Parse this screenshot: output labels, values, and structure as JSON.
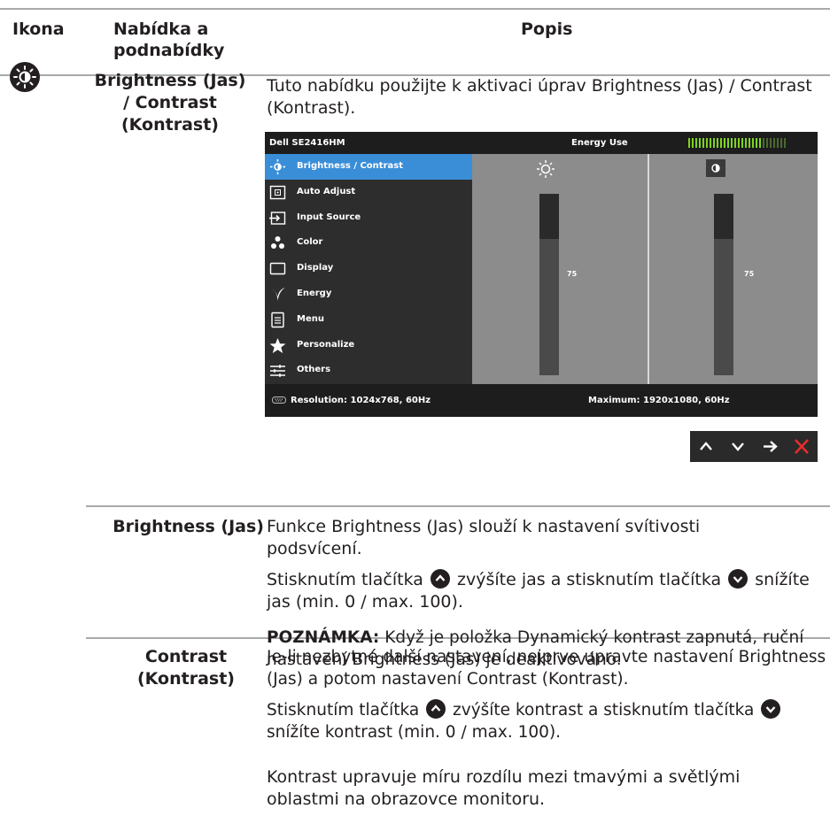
{
  "table": {
    "headers": {
      "icon": "Ikona",
      "menu": "Nabídka a podnabídky",
      "desc": "Popis"
    }
  },
  "main_row": {
    "menu_name": "Brightness (Jas) / Contrast (Kontrast)",
    "description": "Tuto nabídku použijte k aktivaci úprav Brightness (Jas) / Contrast (Kontrast)."
  },
  "osd": {
    "title": "Dell SE2416HM",
    "energy_label": "Energy Use",
    "energy_level": 0.75,
    "menu_items": [
      {
        "label": "Brightness / Contrast",
        "icon": "brightness-icon",
        "selected": true
      },
      {
        "label": "Auto Adjust",
        "icon": "auto-adjust-icon",
        "selected": false
      },
      {
        "label": "Input Source",
        "icon": "input-source-icon",
        "selected": false
      },
      {
        "label": "Color",
        "icon": "color-icon",
        "selected": false
      },
      {
        "label": "Display",
        "icon": "display-icon",
        "selected": false
      },
      {
        "label": "Energy",
        "icon": "energy-icon",
        "selected": false
      },
      {
        "label": "Menu",
        "icon": "menu-icon",
        "selected": false
      },
      {
        "label": "Personalize",
        "icon": "personalize-icon",
        "selected": false
      },
      {
        "label": "Others",
        "icon": "others-icon",
        "selected": false
      }
    ],
    "brightness_value": "75",
    "contrast_value": "75",
    "resolution": "Resolution: 1024x768, 60Hz",
    "maximum": "Maximum: 1920x1080, 60Hz"
  },
  "nav_buttons": [
    "up-icon",
    "down-icon",
    "right-icon",
    "close-icon"
  ],
  "brightness_row": {
    "name": "Brightness (Jas)",
    "p1": "Funkce Brightness (Jas) slouží k nastavení svítivosti podsvícení.",
    "p2a": "Stisknutím tlačítka",
    "p2b": "zvýšíte jas a stisknutím tlačítka",
    "p2c": "snížíte jas (min. 0 / max. 100).",
    "note_label": "POZNÁMKA:",
    "note_text": " Když je položka Dynamický kontrast zapnutá, ruční nastavení Brightness (Jas) je deaktivováno."
  },
  "contrast_row": {
    "name": "Contrast (Kontrast)",
    "p1": "Je-li nezbytné další nastavení, nejprve upravte nastavení Brightness (Jas) a potom nastavení Contrast (Kontrast).",
    "p2a": "Stisknutím tlačítka",
    "p2b": "zvýšíte kontrast a stisknutím tlačítka",
    "p2c": "snížíte kontrast (min. 0 / max. 100).",
    "p3": "Kontrast upravuje míru rozdílu mezi tmavými a světlými oblastmi na obrazovce monitoru."
  },
  "colors": {
    "selected": "#3a8ed8",
    "close": "#e52d2d",
    "rule": "#a7a9ac"
  }
}
